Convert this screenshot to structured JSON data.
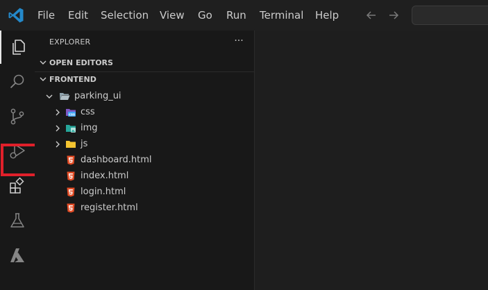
{
  "menu": {
    "items": [
      "File",
      "Edit",
      "Selection",
      "View",
      "Go",
      "Run",
      "Terminal",
      "Help"
    ]
  },
  "activity_bar": {
    "items": [
      {
        "icon": "files-icon",
        "active": true
      },
      {
        "icon": "search-icon"
      },
      {
        "icon": "source-control-icon"
      },
      {
        "icon": "run-debug-icon"
      },
      {
        "icon": "extensions-icon",
        "highlighted": true
      },
      {
        "icon": "testing-flask-icon"
      },
      {
        "icon": "azure-icon"
      }
    ],
    "highlight_color": "#e0202a"
  },
  "sidebar": {
    "title": "EXPLORER",
    "more_actions": "···",
    "open_editors_label": "OPEN EDITORS",
    "folder_label": "FRONTEND",
    "root_folder": "parking_ui",
    "tree": [
      {
        "name": "css",
        "type": "folder",
        "icon": "css-folder-icon",
        "color": "#8d6bd8"
      },
      {
        "name": "img",
        "type": "folder",
        "icon": "img-folder-icon",
        "color": "#26a69a"
      },
      {
        "name": "js",
        "type": "folder",
        "icon": "js-folder-icon",
        "color": "#f4c430"
      },
      {
        "name": "dashboard.html",
        "type": "file",
        "icon": "html-file-icon",
        "color": "#e44d26"
      },
      {
        "name": "index.html",
        "type": "file",
        "icon": "html-file-icon",
        "color": "#e44d26"
      },
      {
        "name": "login.html",
        "type": "file",
        "icon": "html-file-icon",
        "color": "#e44d26"
      },
      {
        "name": "register.html",
        "type": "file",
        "icon": "html-file-icon",
        "color": "#e44d26"
      }
    ]
  },
  "colors": {
    "accent": "#0078d4",
    "vscode_blue": "#2489ca",
    "text": "#cccccc",
    "icon": "#858585"
  }
}
